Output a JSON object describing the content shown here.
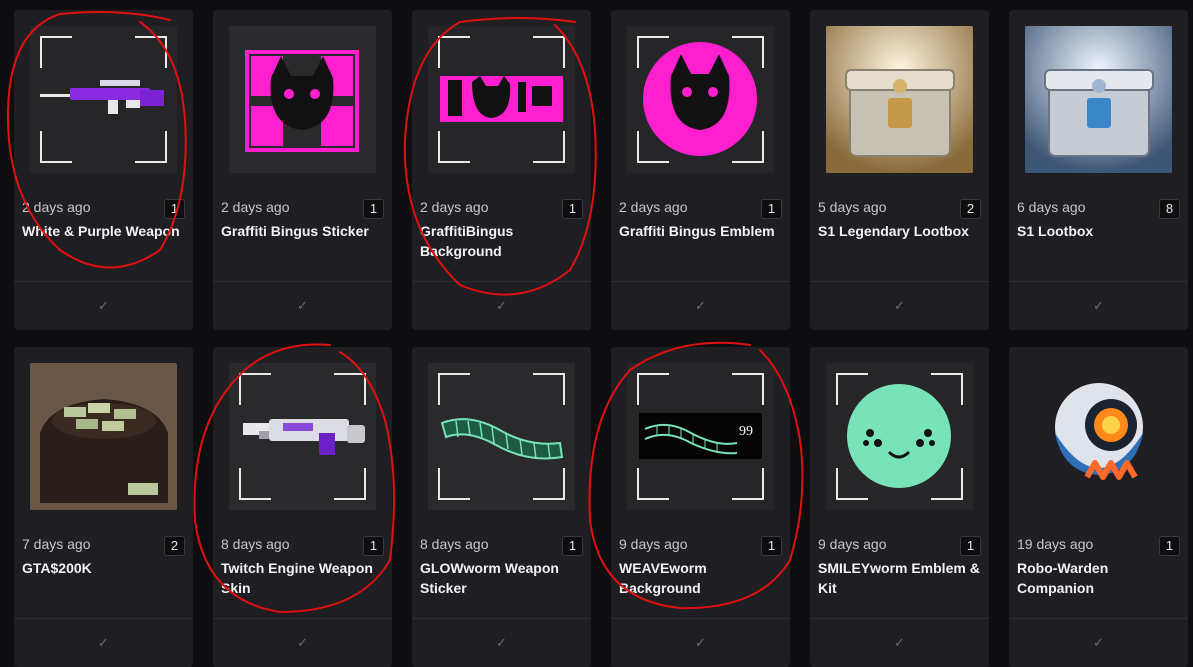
{
  "inventory": {
    "items": [
      {
        "date": "2 days ago",
        "count": "1",
        "name": "White & Purple Weapon",
        "icon": "purple-rifle-icon"
      },
      {
        "date": "2 days ago",
        "count": "1",
        "name": "Graffiti Bingus Sticker",
        "icon": "bingus-sticker-icon"
      },
      {
        "date": "2 days ago",
        "count": "1",
        "name": "GraffitiBingus Background",
        "icon": "bingus-background-icon"
      },
      {
        "date": "2 days ago",
        "count": "1",
        "name": "Graffiti Bingus Emblem",
        "icon": "bingus-emblem-icon"
      },
      {
        "date": "5 days ago",
        "count": "2",
        "name": "S1 Legendary Lootbox",
        "icon": "gold-lootbox-icon"
      },
      {
        "date": "6 days ago",
        "count": "8",
        "name": "S1 Lootbox",
        "icon": "silver-lootbox-icon"
      },
      {
        "date": "7 days ago",
        "count": "2",
        "name": "GTA$200K",
        "icon": "money-bag-icon"
      },
      {
        "date": "8 days ago",
        "count": "1",
        "name": "Twitch Engine Weapon Skin",
        "icon": "weapon-skin-icon"
      },
      {
        "date": "8 days ago",
        "count": "1",
        "name": "GLOWworm Weapon Sticker",
        "icon": "glowworm-icon"
      },
      {
        "date": "9 days ago",
        "count": "1",
        "name": "WEAVEworm Background",
        "icon": "weaveworm-icon"
      },
      {
        "date": "9 days ago",
        "count": "1",
        "name": "SMILEYworm Emblem & Kit",
        "icon": "smiley-face-icon"
      },
      {
        "date": "19 days ago",
        "count": "1",
        "name": "Robo-Warden Companion",
        "icon": "robot-companion-icon"
      }
    ],
    "weaveworm_number": "99",
    "check_glyph": "✓"
  },
  "colors": {
    "page_bg": "#0e0e10",
    "card_bg": "#1f1f23",
    "pink": "#ff1fcf",
    "mint": "#79e3b8",
    "annotation_red": "#e01010"
  }
}
